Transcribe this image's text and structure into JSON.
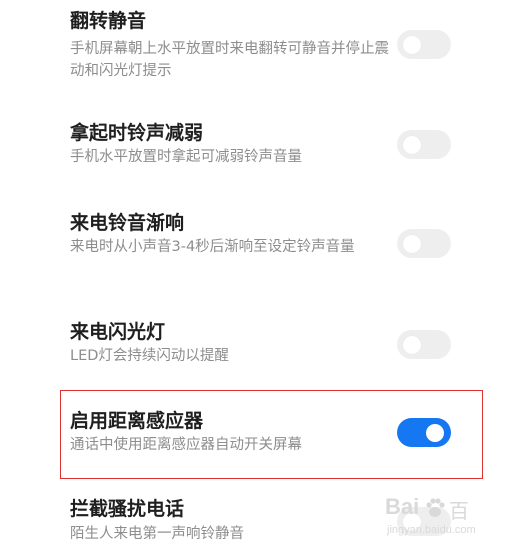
{
  "settings": [
    {
      "title": "翻转静音",
      "description": "手机屏幕朝上水平放置时来电翻转可静音并停止震动和闪光灯提示",
      "enabled": false
    },
    {
      "title": "拿起时铃声减弱",
      "description": "手机水平放置时拿起可减弱铃声音量",
      "enabled": false
    },
    {
      "title": "来电铃音渐响",
      "description": "来电时从小声音3-4秒后渐响至设定铃声音量",
      "enabled": false
    },
    {
      "title": "来电闪光灯",
      "description": "LED灯会持续闪动以提醒",
      "enabled": false
    },
    {
      "title": "启用距离感应器",
      "description": "通话中使用距离感应器自动开关屏幕",
      "enabled": true
    },
    {
      "title": "拦截骚扰电话",
      "description": "陌生人来电第一声响铃静音",
      "enabled": false
    }
  ],
  "watermark": {
    "brand": "Bai",
    "brand_suffix": "百",
    "site": "jingyan.baidu.com"
  },
  "colors": {
    "accent": "#1677f2",
    "highlight_border": "#e0332f",
    "toggle_off": "#eeeeee"
  }
}
